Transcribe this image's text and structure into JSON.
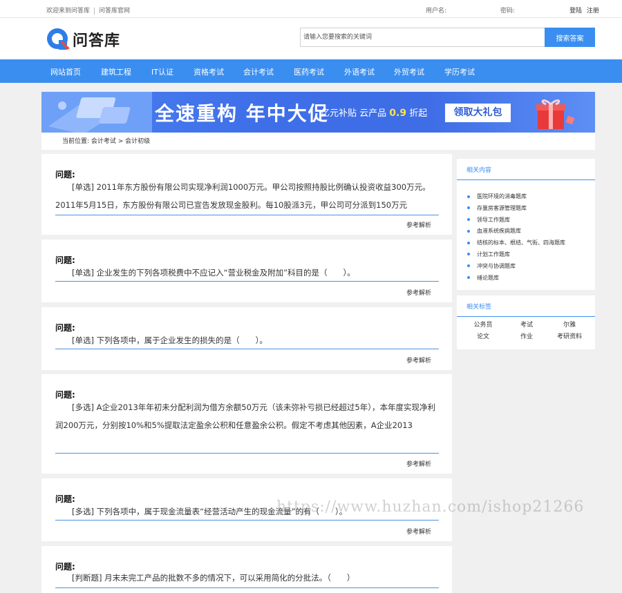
{
  "topbar": {
    "welcome": "欢迎来到问答库",
    "official_site": "问答库官网",
    "username_label": "用户名:",
    "password_label": "密码:",
    "login": "登陆",
    "register": "注册"
  },
  "header": {
    "logo_text": "问答库",
    "search_placeholder": "请输入您要搜索的关键词",
    "search_button": "搜索答案"
  },
  "nav": {
    "items": [
      "网站首页",
      "建筑工程",
      "IT认证",
      "资格考试",
      "会计考试",
      "医药考试",
      "外语考试",
      "外贸考试",
      "学历考试"
    ]
  },
  "banner": {
    "headline": "全速重构 年中大促",
    "sub_prefix": "亿元补贴 云产品",
    "sub_highlight": "0.9",
    "sub_suffix": "折起",
    "cta": "领取大礼包"
  },
  "breadcrumb": {
    "text": "当前位置: 会计考试 > 会计初级"
  },
  "questions": [
    {
      "heading": "问题:",
      "text": "[单选] 2011年东方股份有限公司实现净利润1000万元。甲公司按照持股比例确认投资收益300万元。2011年5月15日，东方股份有限公司已宣告发放现金股利。每10股派3元，甲公司可分派到150万元",
      "answer": "参考解析"
    },
    {
      "heading": "问题:",
      "text": "[单选] 企业发生的下列各项税费中不应记入“营业税金及附加”科目的是（　　）。",
      "answer": "参考解析"
    },
    {
      "heading": "问题:",
      "text": "[单选] 下列各项中，属于企业发生的损失的是（　　）。",
      "answer": "参考解析"
    },
    {
      "heading": "问题:",
      "text": "[多选] A企业2013年年初未分配利润为借方余额50万元（该未弥补亏损已经超过5年），本年度实现净利润200万元，分别按10%和5%提取法定盈余公积和任意盈余公积。假定不考虑其他因素，A企业2013",
      "answer": "参考解析"
    },
    {
      "heading": "问题:",
      "text": "[多选] 下列各项中，属于现金流量表“经营活动产生的现金流量”的有（　　）。",
      "answer": "参考解析"
    },
    {
      "heading": "问题:",
      "text": "[判断题] 月末未完工产品的批数不多的情况下，可以采用简化的分批法。（　　）",
      "answer": ""
    }
  ],
  "sidebar": {
    "related_title": "相关内容",
    "related": [
      "医院环境的消毒题库",
      "存量房客源管理题库",
      "领导工作题库",
      "血液系统疾病题库",
      "结核的标本、根结、气街、四海题库",
      "计划工作题库",
      "冲突与协调题库",
      "绪论题库"
    ],
    "tags_title": "相关标签",
    "tags": [
      "公务员",
      "考试",
      "尔雅",
      "论文",
      "作业",
      "考研资料"
    ]
  },
  "watermark": "https://www.huzhan.com/ishop21266",
  "colors": {
    "accent": "#3a8ef0",
    "banner": "#4a7ff2",
    "highlight": "#ffe14d"
  }
}
